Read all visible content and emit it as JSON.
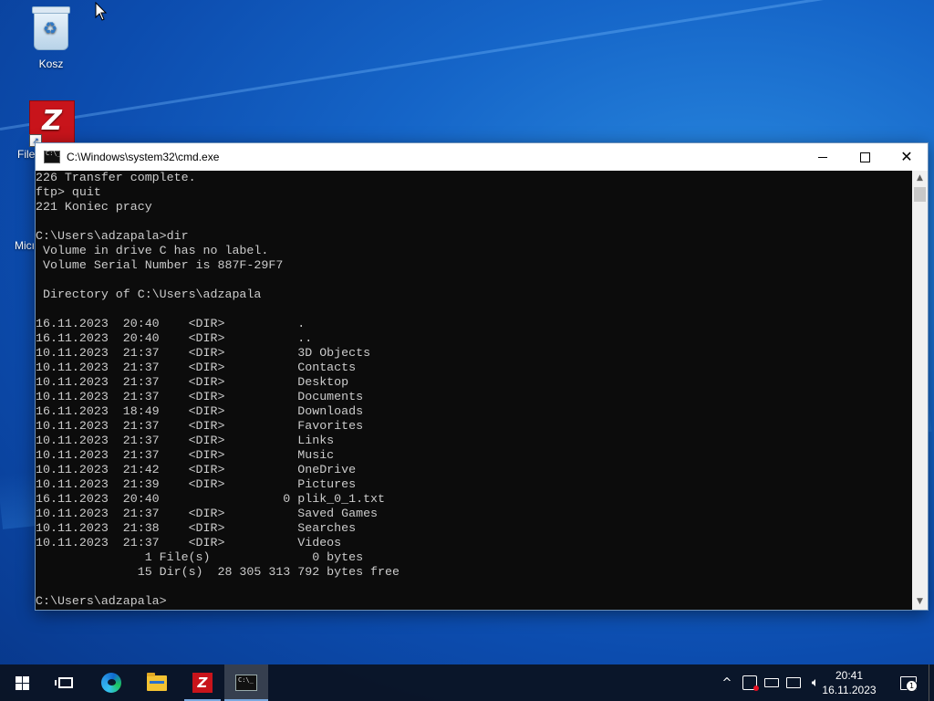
{
  "desktop": {
    "icons": [
      {
        "label": "Kosz",
        "icon": "recycle-bin-icon"
      },
      {
        "label": "File",
        "icon": "filezilla-icon"
      },
      {
        "label": "Micı",
        "icon": "edge-icon"
      }
    ]
  },
  "cmd": {
    "title": "C:\\Windows\\system32\\cmd.exe",
    "lines": [
      "226 Transfer complete.",
      "ftp> quit",
      "221 Koniec pracy",
      "",
      "C:\\Users\\adzapala>dir",
      " Volume in drive C has no label.",
      " Volume Serial Number is 887F-29F7",
      "",
      " Directory of C:\\Users\\adzapala",
      "",
      "16.11.2023  20:40    <DIR>          .",
      "16.11.2023  20:40    <DIR>          ..",
      "10.11.2023  21:37    <DIR>          3D Objects",
      "10.11.2023  21:37    <DIR>          Contacts",
      "10.11.2023  21:37    <DIR>          Desktop",
      "10.11.2023  21:37    <DIR>          Documents",
      "16.11.2023  18:49    <DIR>          Downloads",
      "10.11.2023  21:37    <DIR>          Favorites",
      "10.11.2023  21:37    <DIR>          Links",
      "10.11.2023  21:37    <DIR>          Music",
      "10.11.2023  21:42    <DIR>          OneDrive",
      "10.11.2023  21:39    <DIR>          Pictures",
      "16.11.2023  20:40                 0 plik_0_1.txt",
      "10.11.2023  21:37    <DIR>          Saved Games",
      "10.11.2023  21:38    <DIR>          Searches",
      "10.11.2023  21:37    <DIR>          Videos",
      "               1 File(s)              0 bytes",
      "              15 Dir(s)  28 305 313 792 bytes free",
      "",
      "C:\\Users\\adzapala>"
    ]
  },
  "taskbar": {
    "items": [
      "start-icon",
      "task-view-icon",
      "edge-icon",
      "file-explorer-icon",
      "filezilla-icon",
      "cmd-icon"
    ],
    "tray": {
      "time": "20:41",
      "date": "16.11.2023",
      "notification_count": "1"
    }
  }
}
